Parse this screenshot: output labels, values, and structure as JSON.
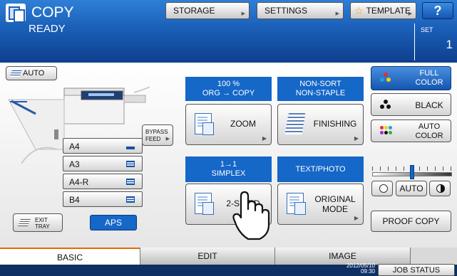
{
  "header": {
    "title": "COPY",
    "status": "READY",
    "storage_label": "STORAGE",
    "settings_label": "SETTINGS",
    "template_label": "TEMPLATE",
    "help_label": "?",
    "set_label": "SET",
    "set_count": "1"
  },
  "left": {
    "auto_label": "AUTO",
    "bypass_label_1": "BYPASS",
    "bypass_label_2": "FEED",
    "papers": [
      {
        "size": "A4",
        "selected": true
      },
      {
        "size": "A3",
        "selected": false
      },
      {
        "size": "A4-R",
        "selected": false
      },
      {
        "size": "B4",
        "selected": false
      }
    ],
    "exit_tray_1": "EXIT",
    "exit_tray_2": "TRAY",
    "aps_label": "APS"
  },
  "middle": {
    "zoom_info_1": "100 %",
    "zoom_info_2": "ORG  →  COPY",
    "zoom_label": "ZOOM",
    "finishing_info_1": "NON-SORT",
    "finishing_info_2": "NON-STAPLE",
    "finishing_label": "FINISHING",
    "sided_info_1": "1→1",
    "sided_info_2": "SIMPLEX",
    "sided_label": "2-SIDED",
    "mode_info": "TEXT/PHOTO",
    "mode_label_1": "ORIGINAL",
    "mode_label_2": "MODE"
  },
  "right": {
    "full_color_1": "FULL",
    "full_color_2": "COLOR",
    "black_label": "BLACK",
    "auto_color_1": "AUTO",
    "auto_color_2": "COLOR",
    "density_auto": "AUTO",
    "density_level": 0.5,
    "proof_copy": "PROOF COPY"
  },
  "tabs": {
    "basic": "BASIC",
    "edit": "EDIT",
    "image": "IMAGE",
    "active": "BASIC"
  },
  "footer": {
    "date": "2012/05/10",
    "time": "09:30",
    "job_status": "JOB STATUS"
  },
  "colors": {
    "header_blue": "#1a5fb8",
    "label_blue": "#1567c8",
    "tab_accent": "#e46a00",
    "footer_navy": "#0d2f63"
  }
}
